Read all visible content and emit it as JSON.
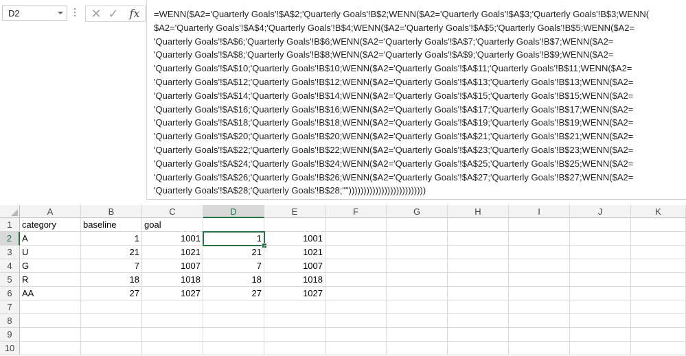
{
  "namebox": {
    "value": "D2"
  },
  "formula_bar": {
    "lines": [
      "=WENN($A2='Quarterly Goals'!$A$2;'Quarterly Goals'!B$2;WENN($A2='Quarterly Goals'!$A$3;'Quarterly Goals'!B$3;WENN(",
      "$A2='Quarterly Goals'!$A$4;'Quarterly Goals'!B$4;WENN($A2='Quarterly Goals'!$A$5;'Quarterly Goals'!B$5;WENN($A2=",
      "'Quarterly Goals'!$A$6;'Quarterly Goals'!B$6;WENN($A2='Quarterly Goals'!$A$7;'Quarterly Goals'!B$7;WENN($A2=",
      "'Quarterly Goals'!$A$8;'Quarterly Goals'!B$8;WENN($A2='Quarterly Goals'!$A$9;'Quarterly Goals'!B$9;WENN($A2=",
      "'Quarterly Goals'!$A$10;'Quarterly Goals'!B$10;WENN($A2='Quarterly Goals'!$A$11;'Quarterly Goals'!B$11;WENN($A2=",
      "'Quarterly Goals'!$A$12;'Quarterly Goals'!B$12;WENN($A2='Quarterly Goals'!$A$13;'Quarterly Goals'!B$13;WENN($A2=",
      "'Quarterly Goals'!$A$14;'Quarterly Goals'!B$14;WENN($A2='Quarterly Goals'!$A$15;'Quarterly Goals'!B$15;WENN($A2=",
      "'Quarterly Goals'!$A$16;'Quarterly Goals'!B$16;WENN($A2='Quarterly Goals'!$A$17;'Quarterly Goals'!B$17;WENN($A2=",
      "'Quarterly Goals'!$A$18;'Quarterly Goals'!B$18;WENN($A2='Quarterly Goals'!$A$19;'Quarterly Goals'!B$19;WENN($A2=",
      "'Quarterly Goals'!$A$20;'Quarterly Goals'!B$20;WENN($A2='Quarterly Goals'!$A$21;'Quarterly Goals'!B$21;WENN($A2=",
      "'Quarterly Goals'!$A$22;'Quarterly Goals'!B$22;WENN($A2='Quarterly Goals'!$A$23;'Quarterly Goals'!B$23;WENN($A2=",
      "'Quarterly Goals'!$A$24;'Quarterly Goals'!B$24;WENN($A2='Quarterly Goals'!$A$25;'Quarterly Goals'!B$25;WENN($A2=",
      "'Quarterly Goals'!$A$26;'Quarterly Goals'!B$26;WENN($A2='Quarterly Goals'!$A$27;'Quarterly Goals'!B$27;WENN($A2=",
      "'Quarterly Goals'!$A$28;'Quarterly Goals'!B$28;\"\"))))))))))))))))))))))))))"
    ]
  },
  "icons": {
    "cancel": "cancel-x-icon",
    "enter": "enter-check-icon",
    "fx": "insert-function-icon"
  },
  "fx_label": "fx",
  "columns": [
    "A",
    "B",
    "C",
    "D",
    "E",
    "F",
    "G",
    "H",
    "I",
    "J",
    "K"
  ],
  "rows": [
    "1",
    "2",
    "3",
    "4",
    "5",
    "6",
    "7",
    "8",
    "9",
    "10"
  ],
  "cells": {
    "A1": "category",
    "B1": "baseline",
    "C1": "goal",
    "A2": "A",
    "B2": "1",
    "C2": "1001",
    "D2": "1",
    "E2": "1001",
    "A3": "U",
    "B3": "21",
    "C3": "1021",
    "D3": "21",
    "E3": "1021",
    "A4": "G",
    "B4": "7",
    "C4": "1007",
    "D4": "7",
    "E4": "1007",
    "A5": "R",
    "B5": "18",
    "C5": "1018",
    "D5": "18",
    "E5": "1018",
    "A6": "AA",
    "B6": "27",
    "C6": "1027",
    "D6": "27",
    "E6": "1027"
  },
  "selection": {
    "column": "D",
    "row": "2"
  },
  "colors": {
    "accent": "#217346"
  }
}
